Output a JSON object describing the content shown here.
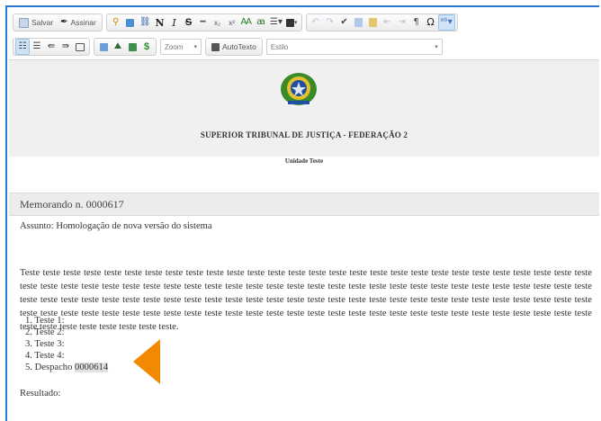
{
  "toolbar": {
    "save_label": "Salvar",
    "sign_label": "Assinar",
    "zoom_label": "Zoom",
    "autotext_label": "AutoTexto",
    "style_label": "Estilo",
    "bold_glyph": "N",
    "italic_glyph": "I",
    "strike_glyph": "S",
    "omega_glyph": "Ω",
    "pilcrow_glyph": "¶",
    "sup_glyph": "x²",
    "sub_glyph": "x₂"
  },
  "header": {
    "org_name": "SUPERIOR TRIBUNAL DE JUSTIÇA - FEDERAÇÃO 2",
    "unit_name": "Unidade Teste"
  },
  "document": {
    "memo_title": "Memorando n. 0000617",
    "subject": "Assunto: Homologação de nova versão do sistema",
    "paragraph": "Teste teste teste teste teste teste teste teste teste teste teste teste teste teste teste teste teste teste teste teste teste teste teste teste teste teste teste teste teste teste teste teste teste teste teste teste teste teste teste teste teste teste teste teste teste teste teste teste teste teste teste teste teste teste teste teste teste teste teste teste teste teste teste teste teste teste teste teste teste teste teste teste teste teste teste teste teste teste teste teste teste teste teste teste teste teste teste teste teste teste teste teste teste teste teste teste teste teste teste teste teste teste teste teste teste teste teste teste teste teste teste teste teste teste teste teste teste teste teste teste.",
    "list_items": [
      {
        "num": "1.",
        "text": "Teste 1:"
      },
      {
        "num": "2.",
        "text": "Teste 2:"
      },
      {
        "num": "3.",
        "text": "Teste 3:"
      },
      {
        "num": "4.",
        "text": "Teste 4:"
      },
      {
        "num": "5.",
        "text": "Despacho "
      }
    ],
    "highlighted_ref": "0000614",
    "result_label": "Resultado:"
  },
  "colors": {
    "accent_border": "#2a78d4",
    "arrow": "#f18a00"
  }
}
